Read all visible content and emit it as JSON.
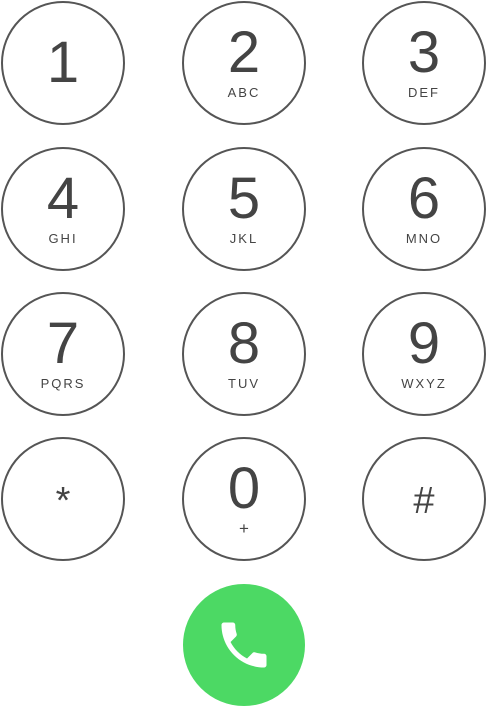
{
  "keypad": {
    "keys": [
      {
        "digit": "1",
        "letters": ""
      },
      {
        "digit": "2",
        "letters": "ABC"
      },
      {
        "digit": "3",
        "letters": "DEF"
      },
      {
        "digit": "4",
        "letters": "GHI"
      },
      {
        "digit": "5",
        "letters": "JKL"
      },
      {
        "digit": "6",
        "letters": "MNO"
      },
      {
        "digit": "7",
        "letters": "PQRS"
      },
      {
        "digit": "8",
        "letters": "TUV"
      },
      {
        "digit": "9",
        "letters": "WXYZ"
      },
      {
        "digit": "*",
        "letters": ""
      },
      {
        "digit": "0",
        "letters": "+"
      },
      {
        "digit": "#",
        "letters": ""
      }
    ]
  },
  "call_button": {
    "icon": "phone-icon",
    "color": "#4cd964"
  },
  "colors": {
    "key_border": "#555555",
    "key_text": "#444444",
    "background": "#ffffff"
  }
}
